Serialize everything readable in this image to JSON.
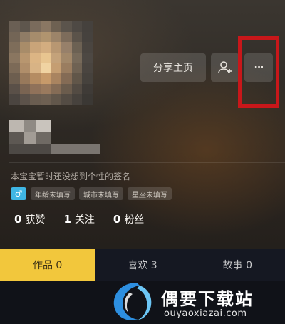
{
  "header": {
    "share_label": "分享主页",
    "add_friend_icon": "add-user-icon",
    "more_icon": "more-icon",
    "more_glyph": "···"
  },
  "profile": {
    "signature": "本宝宝暂时还没想到个性的签名",
    "gender_glyph": "♂",
    "tags": [
      "年龄未填写",
      "城市未填写",
      "星座未填写"
    ]
  },
  "stats": [
    {
      "value": "0",
      "label": "获赞"
    },
    {
      "value": "1",
      "label": "关注"
    },
    {
      "value": "0",
      "label": "粉丝"
    }
  ],
  "tabs": [
    {
      "label": "作品 0"
    },
    {
      "label": "喜欢 3"
    },
    {
      "label": "故事 0"
    }
  ],
  "watermark": {
    "title": "偶要下载站",
    "url": "ouyaoxiazai.com"
  },
  "colors": {
    "highlight": "#c8171a",
    "active_tab": "#f2c73c",
    "gender_badge": "#3fb6e4"
  }
}
